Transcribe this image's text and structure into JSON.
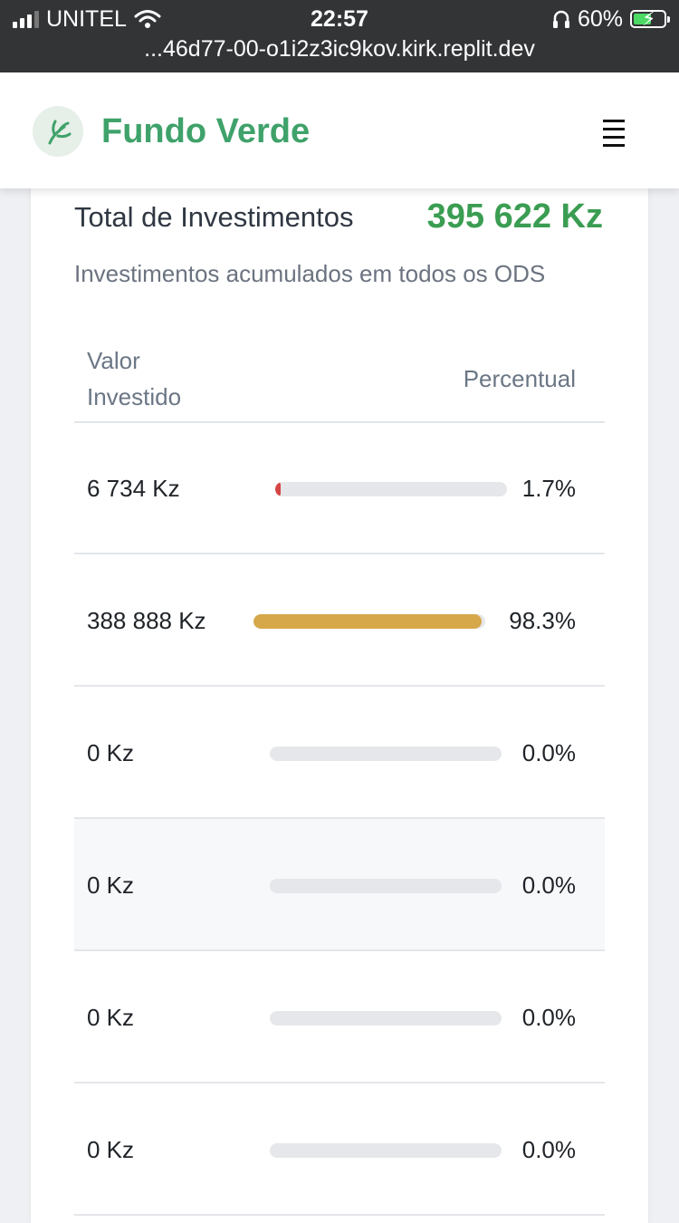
{
  "status_bar": {
    "carrier": "UNITEL",
    "time": "22:57",
    "battery": "60%",
    "battery_level": 0.6,
    "url": "...46d77-00-o1i2z3ic9kov.kirk.replit.dev"
  },
  "header": {
    "brand": "Fundo Verde",
    "logo_icon": "leaf-icon",
    "menu_icon": "hamburger-menu-icon"
  },
  "summary": {
    "total_label": "Total de Investimentos",
    "total_value": "395 622 Kz",
    "subtitle": "Investimentos acumulados em todos os ODS"
  },
  "table": {
    "headers": {
      "value": "Valor Investido",
      "percent": "Percentual"
    },
    "rows": [
      {
        "value": "6 734 Kz",
        "percent": "1.7%",
        "fraction": 0.017,
        "color": "#d64545"
      },
      {
        "value": "388 888 Kz",
        "percent": "98.3%",
        "fraction": 0.983,
        "color": "#d6a84a"
      },
      {
        "value": "0 Kz",
        "percent": "0.0%",
        "fraction": 0,
        "color": "#d64545"
      },
      {
        "value": "0 Kz",
        "percent": "0.0%",
        "fraction": 0,
        "color": "#d64545"
      },
      {
        "value": "0 Kz",
        "percent": "0.0%",
        "fraction": 0,
        "color": "#d64545"
      },
      {
        "value": "0 Kz",
        "percent": "0.0%",
        "fraction": 0,
        "color": "#d64545"
      }
    ]
  },
  "colors": {
    "brand": "#3fa26a",
    "total": "#3a9d52",
    "track": "#e6e7ea"
  }
}
